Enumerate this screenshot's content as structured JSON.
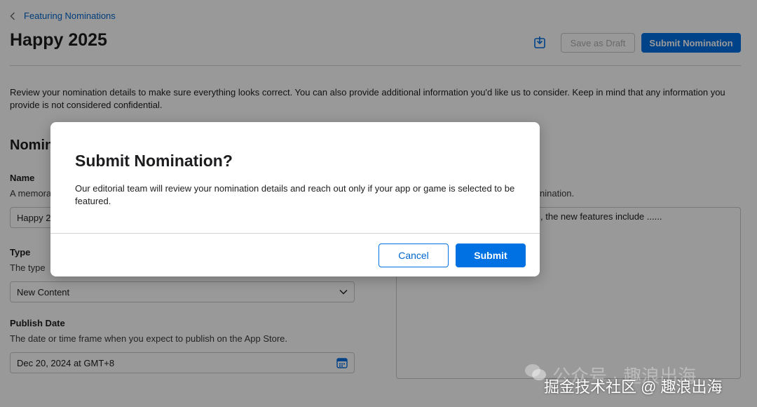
{
  "breadcrumb": {
    "label": "Featuring Nominations"
  },
  "page": {
    "title": "Happy 2025"
  },
  "toolbar": {
    "save_draft_label": "Save as Draft",
    "submit_label": "Submit Nomination"
  },
  "intro": {
    "text": "Review your nomination details to make sure everything looks correct. You can also provide additional information you'd like us to consider. Keep in mind that any information you provide is not considered confidential."
  },
  "section": {
    "title_visible": "Nomin"
  },
  "fields": {
    "name": {
      "label": "Name",
      "help_visible": "A memora",
      "value_visible": "Happy 2"
    },
    "type": {
      "label": "Type",
      "help_visible": "The type",
      "value": "New Content"
    },
    "publish_date": {
      "label": "Publish Date",
      "help": "The date or time frame when you expect to publish on the App Store.",
      "value": "Dec 20, 2024 at GMT+8"
    },
    "description": {
      "help_visible": "nination.",
      "value_visible": ", the new features include ......"
    }
  },
  "modal": {
    "title": "Submit Nomination?",
    "body": "Our editorial team will review your nomination details and reach out only if your app or game is selected to be featured.",
    "cancel_label": "Cancel",
    "submit_label": "Submit"
  },
  "watermark": {
    "faint": "公众号 · 趣浪出海",
    "text": "掘金技术社区 @ 趣浪出海"
  },
  "colors": {
    "accent": "#0071e3",
    "link": "#0066cc",
    "overlay": "rgba(0,0,0,0.40)"
  },
  "icons": [
    "chevron-left-icon",
    "download-icon",
    "chevron-down-icon",
    "calendar-icon",
    "wechat-icon"
  ]
}
